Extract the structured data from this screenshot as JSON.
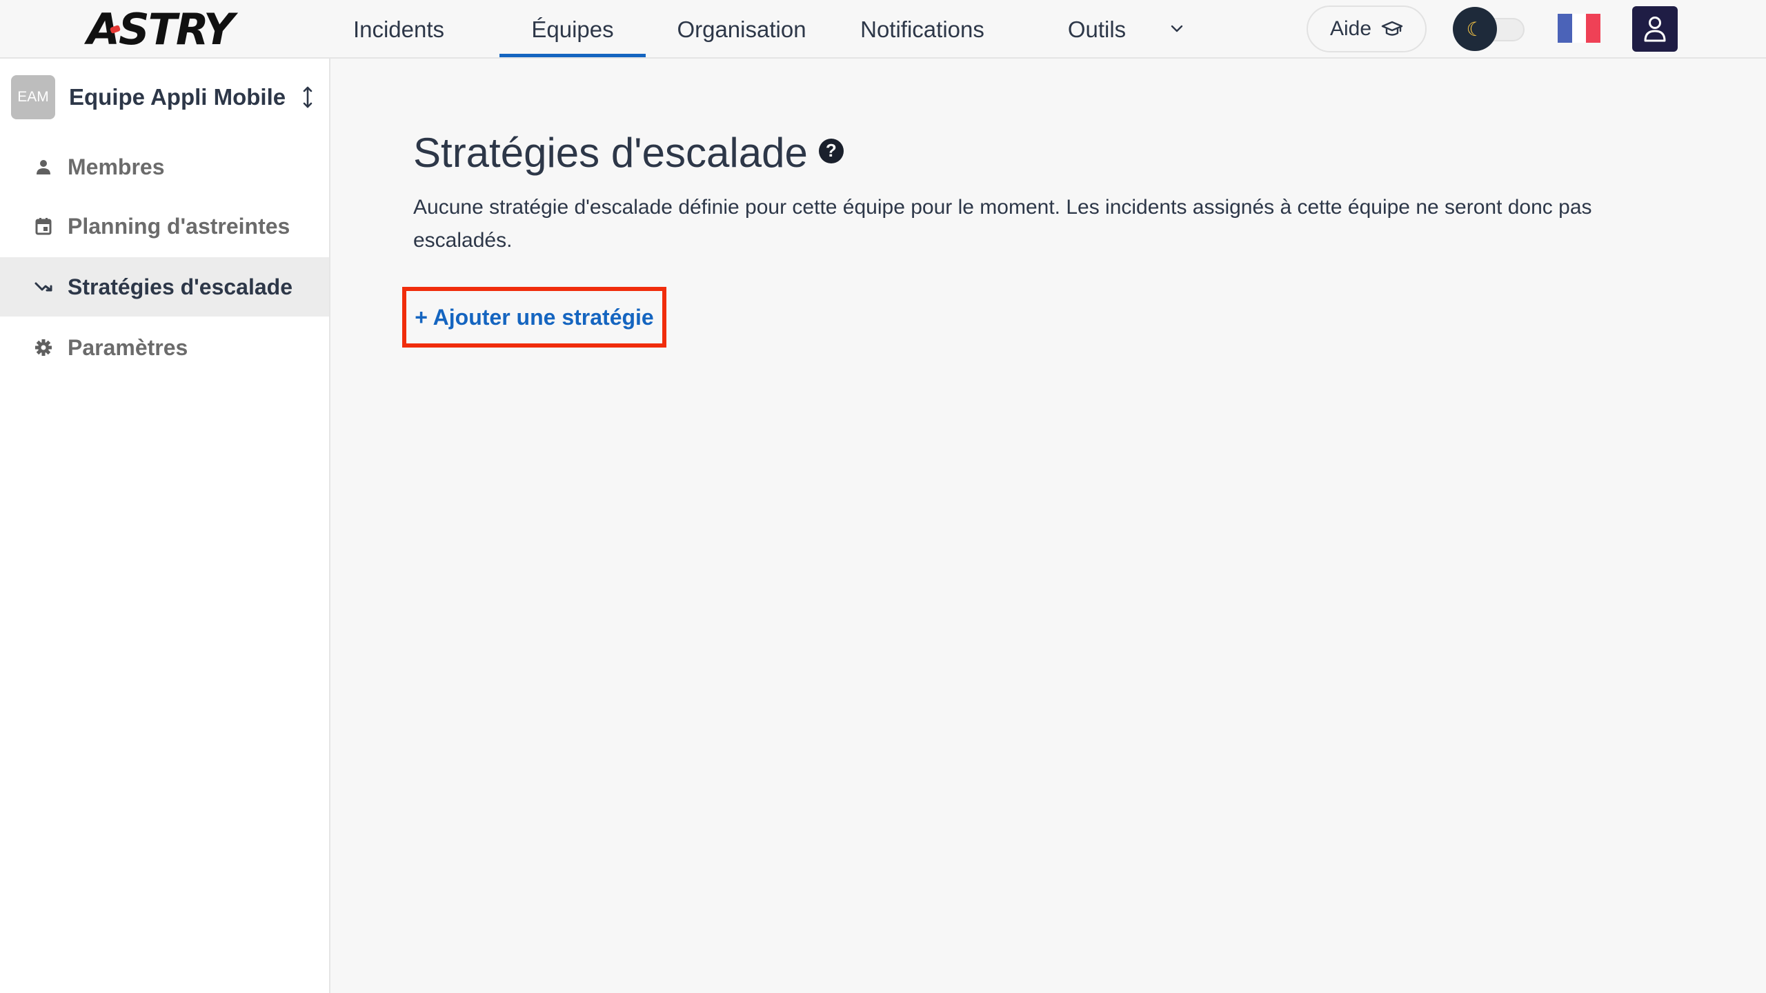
{
  "app": {
    "logo_text": "ASTRY"
  },
  "nav": {
    "items": [
      {
        "label": "Incidents"
      },
      {
        "label": "Équipes"
      },
      {
        "label": "Organisation"
      },
      {
        "label": "Notifications"
      },
      {
        "label": "Outils"
      }
    ],
    "active": "Équipes",
    "help_label": "Aide",
    "dark_mode": false,
    "language": "fr"
  },
  "sidebar": {
    "team_badge": "EAM",
    "team_name": "Equipe Appli Mobile",
    "items": [
      {
        "label": "Membres",
        "icon": "person-icon"
      },
      {
        "label": "Planning d'astreintes",
        "icon": "calendar-icon"
      },
      {
        "label": "Stratégies d'escalade",
        "icon": "escalation-icon",
        "active": true
      },
      {
        "label": "Paramètres",
        "icon": "gear-icon"
      }
    ]
  },
  "main": {
    "title": "Stratégies d'escalade",
    "description": "Aucune stratégie d'escalade définie pour cette équipe pour le moment. Les incidents assignés à cette équipe ne seront donc pas escaladés.",
    "add_button_label": "+ Ajouter une stratégie"
  },
  "colors": {
    "accent": "#1565c0",
    "highlight_border": "#f02d0c",
    "avatar_bg": "#1f1d45"
  }
}
